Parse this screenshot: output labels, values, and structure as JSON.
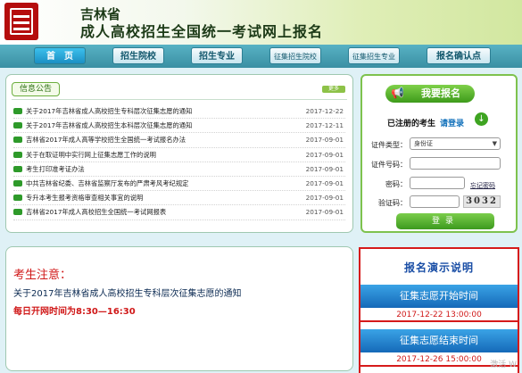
{
  "header": {
    "title_line1": "吉林省",
    "title_line2": "成人高校招生全国统一考试网上报名"
  },
  "nav": [
    {
      "label": "首　页"
    },
    {
      "label": "招生院校"
    },
    {
      "label": "招生专业"
    },
    {
      "label": "征集招生院校"
    },
    {
      "label": "征集招生专业"
    },
    {
      "label": "报名确认点"
    }
  ],
  "notice": {
    "tab": "信息公告",
    "more": "更多",
    "items": [
      {
        "text": "关于2017年吉林省成人高校招生专科层次征集志愿的通知",
        "date": "2017-12-22"
      },
      {
        "text": "关于2017年吉林省成人高校招生本科层次征集志愿的通知",
        "date": "2017-12-11"
      },
      {
        "text": "吉林省2017年成人高等学校招生全国统一考试报名办法",
        "date": "2017-09-01"
      },
      {
        "text": "关于在取证明中实行网上征集志愿工作的说明",
        "date": "2017-09-01"
      },
      {
        "text": "考生打印准考证办法",
        "date": "2017-09-01"
      },
      {
        "text": "中共吉林省纪委、吉林省监察厅发布的严肃考风考纪规定",
        "date": "2017-09-01"
      },
      {
        "text": "专升本考生报考资格审查相关事宜的说明",
        "date": "2017-09-01"
      },
      {
        "text": "吉林省2017年成人高校招生全国统一考试网报表",
        "date": "2017-09-01"
      }
    ]
  },
  "register": {
    "heading": "我要报名",
    "sub": "已注册的考生",
    "login_link": "请登录",
    "doc_type_label": "证件类型：",
    "doc_type_value": "身份证",
    "doc_no_label": "证件号码：",
    "password_label": "密码：",
    "forgot": "忘记密码",
    "captcha_label": "验证码：",
    "captcha_image": "3032",
    "login_button": "登录"
  },
  "attention": {
    "title": "考生注意：",
    "text": "关于2017年吉林省成人高校招生专科层次征集志愿的通知",
    "time": "每日开网时间为8:30—16:30"
  },
  "demo": {
    "header": "报名演示说明",
    "start_label": "征集志愿开始时间",
    "start_date": "2017-12-22 13:00:00",
    "end_label": "征集志愿结束时间",
    "end_date": "2017-12-26 15:00:00"
  },
  "watermark": "激活 W"
}
